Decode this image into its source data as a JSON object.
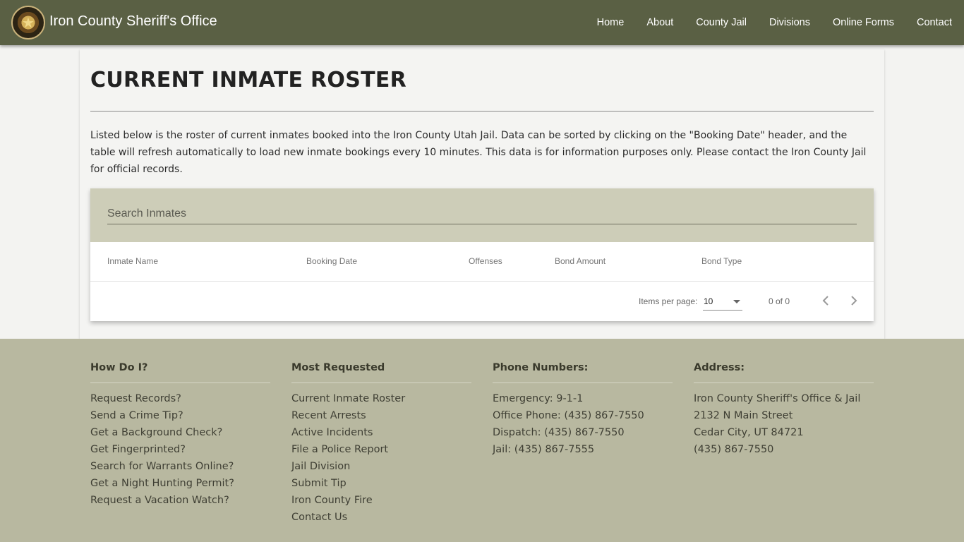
{
  "header": {
    "brand": "Iron County Sheriff's Office",
    "nav": [
      "Home",
      "About",
      "County Jail",
      "Divisions",
      "Online Forms",
      "Contact"
    ]
  },
  "main": {
    "title": "CURRENT INMATE ROSTER",
    "intro": "Listed below is the roster of current inmates booked into the Iron County Utah Jail. Data can be sorted by clicking on the \"Booking Date\" header, and the table will refresh automatically to load new inmate bookings every 10 minutes. This data is for information purposes only. Please contact the Iron County Jail for official records.",
    "search_placeholder": "Search Inmates",
    "columns": [
      "Inmate Name",
      "Booking Date",
      "Offenses",
      "Bond Amount",
      "Bond Type"
    ],
    "pager": {
      "items_per_page_label": "Items per page:",
      "items_per_page": "10",
      "range": "0 of 0"
    }
  },
  "footer": {
    "columns": [
      {
        "heading": "How Do I?",
        "items": [
          "Request Records?",
          "Send a Crime Tip?",
          "Get a Background Check?",
          "Get Fingerprinted?",
          "Search for Warrants Online?",
          "Get a Night Hunting Permit?",
          "Request a Vacation Watch?"
        ]
      },
      {
        "heading": "Most Requested",
        "items": [
          "Current Inmate Roster",
          "Recent Arrests",
          "Active Incidents",
          "File a Police Report",
          "Jail Division",
          "Submit Tip",
          "Iron County Fire",
          "Contact Us"
        ]
      },
      {
        "heading": "Phone Numbers:",
        "items": [
          "Emergency: 9-1-1",
          "Office Phone: (435) 867-7550",
          "Dispatch: (435) 867-7550",
          "Jail: (435) 867-7555"
        ]
      },
      {
        "heading": "Address:",
        "items": [
          "Iron County Sheriff's Office & Jail",
          "2132 N Main Street",
          "Cedar City, UT 84721",
          "(435) 867-7550"
        ]
      }
    ]
  },
  "colors": {
    "header_bg": "#5a6044",
    "search_bg": "#cdcdb8",
    "footer_bg": "#b8b8a0"
  }
}
